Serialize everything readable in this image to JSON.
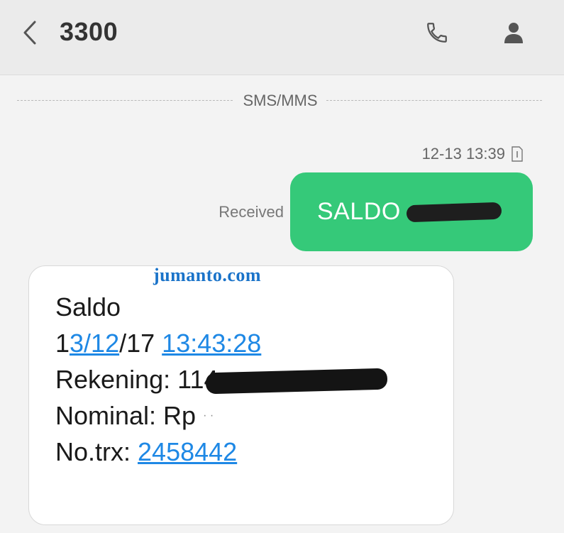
{
  "header": {
    "back_icon": "chevron-left-icon",
    "title": "3300",
    "call_icon": "phone-icon",
    "contact_icon": "person-icon"
  },
  "divider": {
    "label": "SMS/MMS"
  },
  "sent": {
    "timestamp": "12-13 13:39",
    "sim_icon": "sim-1-icon",
    "status": "Received",
    "text": "SALDO"
  },
  "received": {
    "watermark": "jumanto.com",
    "line1": "Saldo",
    "date_prefix": "1",
    "date_link": "3/12",
    "date_suffix": "/17",
    "time_link": "13:43:28",
    "account_label": "Rekening: 114",
    "nominal_label": "Nominal: Rp",
    "nominal_specks": "· ·",
    "trx_label": "No.trx:",
    "trx_link": "2458442"
  },
  "colors": {
    "header_bg": "#ebebeb",
    "background": "#f3f3f3",
    "sent_bubble": "#35c979",
    "link": "#1e88e5",
    "watermark": "#1a73c9"
  }
}
